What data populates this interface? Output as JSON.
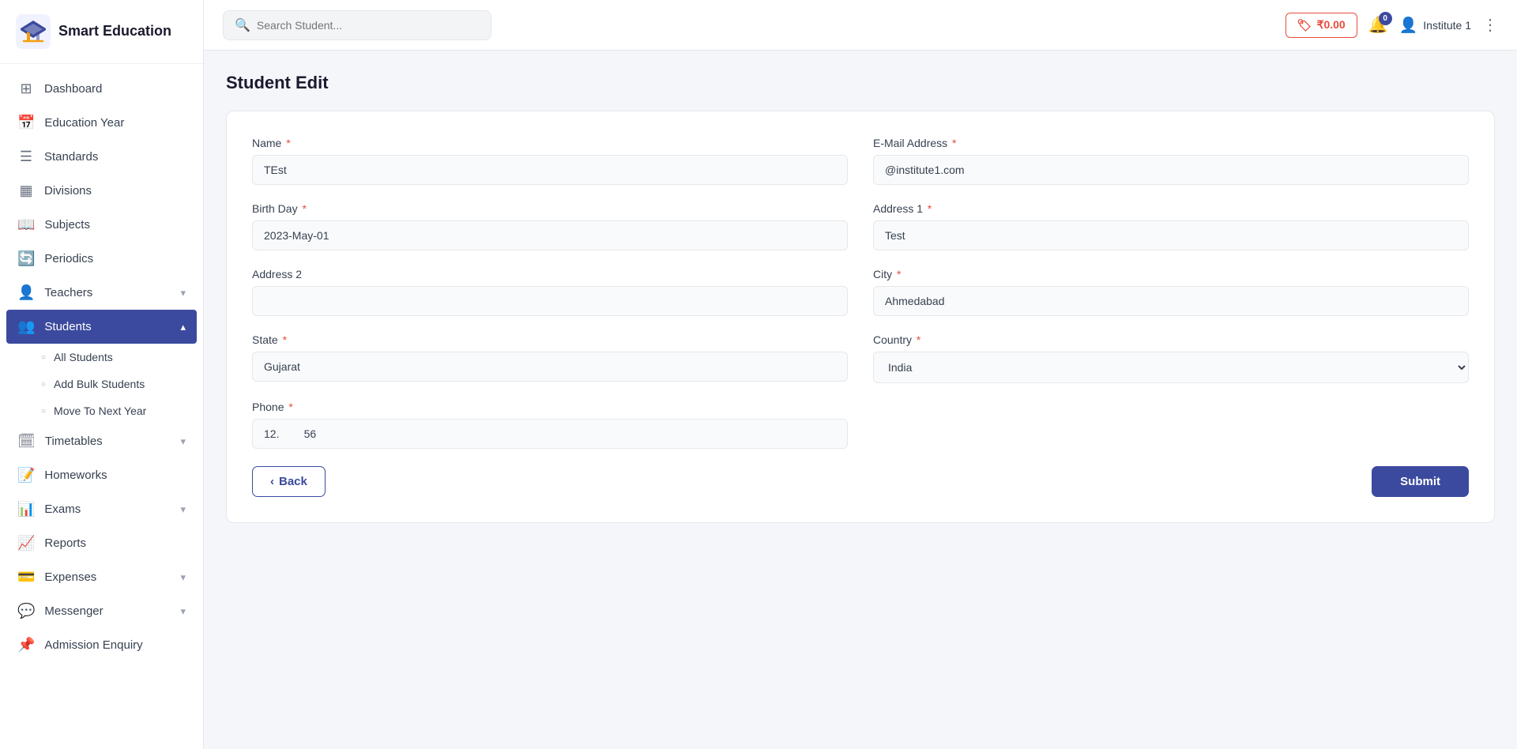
{
  "app": {
    "title": "Smart Education"
  },
  "topbar": {
    "search_placeholder": "Search Student...",
    "wallet_amount": "₹0.00",
    "notif_count": "0",
    "user_name": "Institute 1"
  },
  "sidebar": {
    "items": [
      {
        "id": "dashboard",
        "label": "Dashboard",
        "icon": "⊞",
        "active": false,
        "expandable": false
      },
      {
        "id": "education-year",
        "label": "Education Year",
        "icon": "📅",
        "active": false,
        "expandable": false
      },
      {
        "id": "standards",
        "label": "Standards",
        "icon": "📋",
        "active": false,
        "expandable": false
      },
      {
        "id": "divisions",
        "label": "Divisions",
        "icon": "🔢",
        "active": false,
        "expandable": false
      },
      {
        "id": "subjects",
        "label": "Subjects",
        "icon": "📚",
        "active": false,
        "expandable": false
      },
      {
        "id": "periodics",
        "label": "Periodics",
        "icon": "🔄",
        "active": false,
        "expandable": false
      },
      {
        "id": "teachers",
        "label": "Teachers",
        "icon": "👤",
        "active": false,
        "expandable": true
      },
      {
        "id": "students",
        "label": "Students",
        "icon": "👥",
        "active": true,
        "expandable": true
      },
      {
        "id": "timetables",
        "label": "Timetables",
        "icon": "🗓",
        "active": false,
        "expandable": true
      },
      {
        "id": "homeworks",
        "label": "Homeworks",
        "icon": "📝",
        "active": false,
        "expandable": false
      },
      {
        "id": "exams",
        "label": "Exams",
        "icon": "📊",
        "active": false,
        "expandable": true
      },
      {
        "id": "reports",
        "label": "Reports",
        "icon": "📈",
        "active": false,
        "expandable": false
      },
      {
        "id": "expenses",
        "label": "Expenses",
        "icon": "💳",
        "active": false,
        "expandable": true
      },
      {
        "id": "messenger",
        "label": "Messenger",
        "icon": "💬",
        "active": false,
        "expandable": true
      },
      {
        "id": "admission-enquiry",
        "label": "Admission Enquiry",
        "icon": "📌",
        "active": false,
        "expandable": false
      }
    ],
    "students_sub_items": [
      {
        "id": "all-students",
        "label": "All Students"
      },
      {
        "id": "add-bulk-students",
        "label": "Add Bulk Students"
      },
      {
        "id": "move-to-next-year",
        "label": "Move To Next Year"
      }
    ]
  },
  "page": {
    "title": "Student Edit"
  },
  "form": {
    "name_label": "Name",
    "name_value": "TEst",
    "email_label": "E-Mail Address",
    "email_value": "@institute1.com",
    "birthday_label": "Birth Day",
    "birthday_value": "2023-May-01",
    "address1_label": "Address 1",
    "address1_value": "Test",
    "address2_label": "Address 2",
    "address2_value": "",
    "city_label": "City",
    "city_value": "Ahmedabad",
    "state_label": "State",
    "state_value": "Gujarat",
    "country_label": "Country",
    "country_value": "India",
    "phone_label": "Phone",
    "phone_value": "12.        56",
    "back_label": "Back",
    "submit_label": "Submit",
    "required_mark": "*"
  }
}
